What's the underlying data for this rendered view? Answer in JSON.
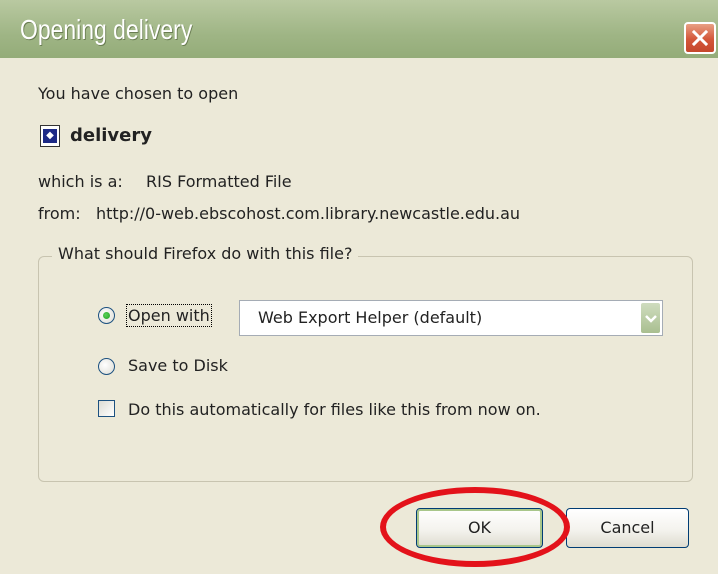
{
  "window": {
    "title": "Opening delivery"
  },
  "dialog": {
    "intro": "You have chosen to open",
    "file_name": "delivery",
    "type_label": "which is a:",
    "type_value": "RIS Formatted File",
    "from_label": "from:",
    "from_value": "http://0-web.ebscohost.com.library.newcastle.edu.au"
  },
  "group": {
    "legend": "What should Firefox do with this file?",
    "open_with_label": "Open with",
    "open_with_selected": true,
    "app_select_value": "Web Export Helper (default)",
    "save_to_disk_label": "Save to Disk",
    "save_to_disk_selected": false,
    "auto_checkbox_label": "Do this automatically for files like this from now on.",
    "auto_checked": false
  },
  "buttons": {
    "ok": "OK",
    "cancel": "Cancel"
  },
  "colors": {
    "annotation": "#e3121a",
    "titlebar": "#9fb585",
    "dialog_bg": "#ece9d8"
  },
  "icons": {
    "close": "close-icon",
    "file": "file-icon",
    "dropdown": "chevron-down-icon"
  }
}
